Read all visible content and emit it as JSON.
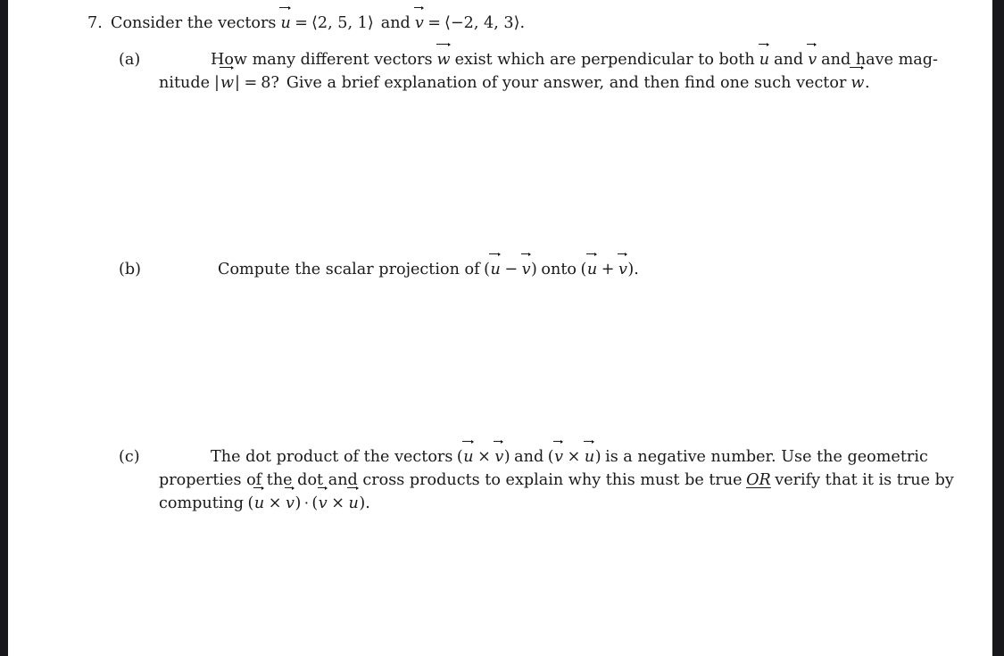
{
  "document": {
    "type": "math-worksheet-problem",
    "background_color": "#ffffff",
    "text_color": "#1a1a1a",
    "scan_band_color": "#18181a"
  },
  "problem": {
    "number": "7.",
    "stem": {
      "text_before": "Consider the vectors",
      "u_symbol": "u",
      "equals": "=",
      "u_vector": "⟨2, 5, 1⟩",
      "u_components": [
        "2",
        "5",
        "1"
      ],
      "conjunction": "and",
      "v_symbol": "v",
      "v_vector": "⟨−2, 4, 3⟩",
      "v_components": [
        "−2",
        "4",
        "3"
      ],
      "period": "."
    },
    "parts": [
      {
        "label": "(a)",
        "lines": [
          {
            "segments": [
              "How many different vectors ",
              "w",
              " exist which are perpendicular to both ",
              "u",
              " and ",
              "v",
              " and have mag-"
            ],
            "plain": "How many different vectors w⃗ exist which are perpendicular to both u⃗ and v⃗ and have mag-"
          },
          {
            "plain": "nitude |w⃗| = 8? Give a brief explanation of your answer, and then find one such vector w⃗.",
            "magnitude_symbol": "w",
            "magnitude_value": "8",
            "text_after": "Give a brief explanation of your answer, and then find one such vector",
            "trailing_symbol": "w"
          }
        ]
      },
      {
        "label": "(b)",
        "lines": [
          {
            "plain": "Compute the scalar projection of (u⃗ − v⃗) onto (u⃗ + v⃗).",
            "text_before": "Compute the scalar projection of",
            "expr_1": "(u⃗ − v⃗)",
            "connector": "onto",
            "expr_2": "(u⃗ + v⃗)",
            "period": "."
          }
        ]
      },
      {
        "label": "(c)",
        "lines": [
          {
            "plain": "The dot product of the vectors (u⃗ × v⃗) and (v⃗ × u⃗) is a negative number.  Use the geometric",
            "text_before": "The dot product of the vectors",
            "expr_1": "(u⃗ × v⃗)",
            "connector": "and",
            "expr_2": "(v⃗ × u⃗)",
            "text_after": "is a negative number.  Use the geometric"
          },
          {
            "plain": "properties of the dot and cross products to explain why this must be true OR verify that it is true by",
            "text_before": "properties of the dot and cross products to explain why this must be true",
            "emphasis": "OR",
            "text_after": "verify that it is true by"
          },
          {
            "plain": "computing (u⃗ × v⃗) · (v⃗ × u⃗).",
            "text_before": "computing",
            "expr_1": "(u⃗ × v⃗)",
            "dot_operator": "·",
            "expr_2": "(v⃗ × u⃗)",
            "period": "."
          }
        ]
      }
    ]
  },
  "symbols": {
    "u": "u",
    "v": "v",
    "w": "w",
    "times": "×",
    "cdot": "·",
    "minus": "−",
    "plus": "+",
    "equals": "=",
    "angle_open": "⟨",
    "angle_close": "⟩",
    "bar": "|",
    "paren_open": "(",
    "paren_close": ")"
  }
}
